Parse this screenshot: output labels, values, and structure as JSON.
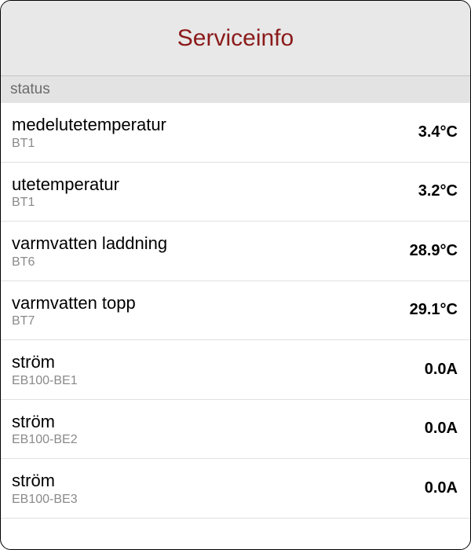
{
  "header": {
    "title": "Serviceinfo"
  },
  "sections": [
    {
      "label": "status"
    }
  ],
  "rows": [
    {
      "label": "medelutetemperatur",
      "sublabel": "BT1",
      "value": "3.4°C"
    },
    {
      "label": "utetemperatur",
      "sublabel": "BT1",
      "value": "3.2°C"
    },
    {
      "label": "varmvatten laddning",
      "sublabel": "BT6",
      "value": "28.9°C"
    },
    {
      "label": "varmvatten topp",
      "sublabel": "BT7",
      "value": "29.1°C"
    },
    {
      "label": "ström",
      "sublabel": "EB100-BE1",
      "value": "0.0A"
    },
    {
      "label": "ström",
      "sublabel": "EB100-BE2",
      "value": "0.0A"
    },
    {
      "label": "ström",
      "sublabel": "EB100-BE3",
      "value": "0.0A"
    }
  ]
}
